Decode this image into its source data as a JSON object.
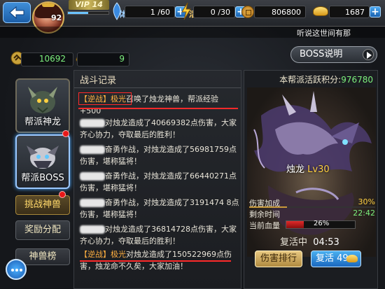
{
  "header": {
    "vip_label": "VIP 14",
    "player_level": "92",
    "stamina": {
      "label": "体",
      "value": "1 /60"
    },
    "vigor": {
      "label": "活",
      "value": "0 /30"
    },
    "coins": "806800",
    "gold": "1687",
    "plus_symbol": "+",
    "exp_fraction": 0.5
  },
  "marquee": {
    "text": "听说这世间有那"
  },
  "stats": {
    "contribution": "10692",
    "rank_count": "9"
  },
  "boss_explain_label": "BOSS说明",
  "sidebar": {
    "cards": [
      {
        "label": "帮派神龙"
      },
      {
        "label": "帮派BOSS"
      }
    ],
    "buttons": [
      {
        "label": "挑战神兽"
      },
      {
        "label": "奖励分配"
      },
      {
        "label": "神兽榜"
      }
    ]
  },
  "battle_log": {
    "title": "战斗记录",
    "messages": [
      {
        "tag": "【逆战】",
        "name": "极光",
        "text": "召唤了烛龙神兽，帮派经验+500"
      },
      {
        "text": "对烛龙造成了40669382点伤害，大家齐心协力，夺取最后的胜利！"
      },
      {
        "text": "奋勇作战，对烛龙造成了56981759点伤害，堪称猛将！"
      },
      {
        "text": "奋勇作战，对烛龙造成了66440271点伤害，堪称猛将！"
      },
      {
        "text": "奋勇作战，对烛龙造成了3191474 8点伤害，堪称猛将！"
      },
      {
        "text": "对烛龙造成了36814728点伤害，大家齐心协力，夺取最后的胜利！"
      },
      {
        "tag": "【逆战】",
        "name": "极光",
        "text": "对烛龙造成了150522969点伤害，烛龙命不久矣，大家加油！"
      }
    ]
  },
  "boss": {
    "activity_label": "本帮派活跃积分:",
    "activity_score": "976780",
    "name": "烛龙",
    "level": "Lv30",
    "damage_bonus_label": "伤害加成",
    "damage_bonus": "30%",
    "damage_bonus_fraction": 0.3,
    "remaining_time_label": "剩余时间",
    "remaining_time": "22:42",
    "hp_label": "当前血量",
    "hp_percent": "26%",
    "hp_fraction": 0.26,
    "revive_label": "复活中",
    "revive_time": "04:53",
    "rank_button": "伤害排行",
    "revive_button": "复活 49"
  },
  "colors": {
    "accent_green": "#7df07d",
    "accent_orange": "#ffb040",
    "highlight_red": "#ff2a2a",
    "button_blue": "#1a68c0"
  }
}
